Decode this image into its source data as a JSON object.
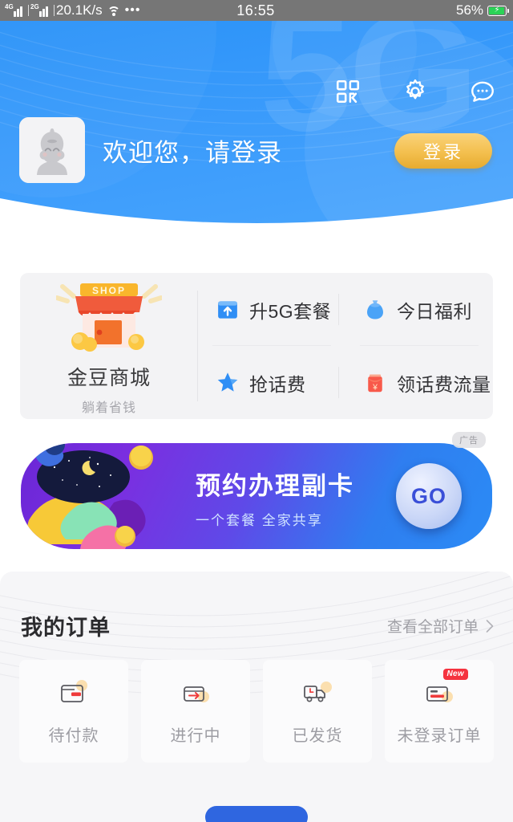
{
  "statusbar": {
    "signal1_label": "4G",
    "signal2_label": "2G",
    "netspeed": "20.1K/s",
    "wifi_icon": "wifi-icon",
    "more_icon": "ellipsis-icon",
    "time": "16:55",
    "battery_percent": "56%",
    "battery_state": "charging"
  },
  "header": {
    "watermark": "5G",
    "icons": [
      {
        "name": "qr-scan-icon",
        "label": "扫一扫"
      },
      {
        "name": "gear-icon",
        "label": "设置"
      },
      {
        "name": "chat-bubble-icon",
        "label": "消息"
      }
    ],
    "avatar_alt": "默认头像",
    "welcome_text": "欢迎您，请登录",
    "login_label": "登录",
    "accent_color": "#3a9bfb",
    "login_color": "#f3bf4e"
  },
  "quick": {
    "shop": {
      "icon": "shop-storefront-icon",
      "icon_text": "SHOP",
      "title": "金豆商城",
      "subtitle": "躺着省钱"
    },
    "links": [
      {
        "name": "upgrade-5g-plan",
        "icon": "upload-box-icon",
        "label": "升5G套餐",
        "color": "#2f8ef5"
      },
      {
        "name": "today-benefits",
        "icon": "money-bag-icon",
        "label": "今日福利",
        "color": "#4aa3f7"
      },
      {
        "name": "grab-phone-credit",
        "icon": "star-icon",
        "label": "抢话费",
        "color": "#2f8ef5"
      },
      {
        "name": "claim-credit-data",
        "icon": "red-envelope-icon",
        "label": "领话费流量",
        "color": "#f8594a"
      }
    ]
  },
  "banner": {
    "ad_badge": "广告",
    "title": "预约办理副卡",
    "subtitle": "一个套餐  全家共享",
    "go_label": "GO",
    "gradient_from": "#6a27d6",
    "gradient_to": "#2b8bf5"
  },
  "orders": {
    "title": "我的订单",
    "more_label": "查看全部订单",
    "more_icon": "chevron-right-icon",
    "tiles": [
      {
        "name": "order-unpaid",
        "icon": "wallet-icon",
        "label": "待付款",
        "badge": ""
      },
      {
        "name": "order-in-progress",
        "icon": "box-arrow-icon",
        "label": "进行中",
        "badge": ""
      },
      {
        "name": "order-shipped",
        "icon": "truck-icon",
        "label": "已发货",
        "badge": ""
      },
      {
        "name": "order-not-logged-in",
        "icon": "card-icon",
        "label": "未登录订单",
        "badge": "New"
      }
    ]
  }
}
